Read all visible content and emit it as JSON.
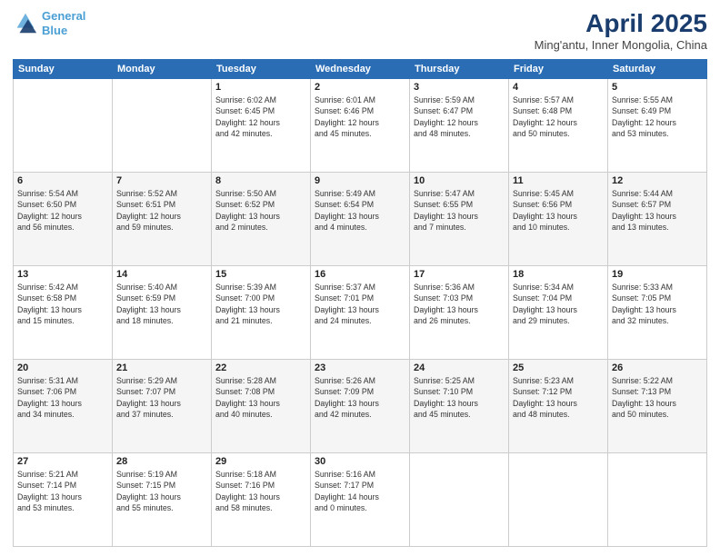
{
  "header": {
    "logo_line1": "General",
    "logo_line2": "Blue",
    "month_year": "April 2025",
    "location": "Ming'antu, Inner Mongolia, China"
  },
  "weekdays": [
    "Sunday",
    "Monday",
    "Tuesday",
    "Wednesday",
    "Thursday",
    "Friday",
    "Saturday"
  ],
  "weeks": [
    [
      {
        "day": "",
        "info": ""
      },
      {
        "day": "",
        "info": ""
      },
      {
        "day": "1",
        "info": "Sunrise: 6:02 AM\nSunset: 6:45 PM\nDaylight: 12 hours\nand 42 minutes."
      },
      {
        "day": "2",
        "info": "Sunrise: 6:01 AM\nSunset: 6:46 PM\nDaylight: 12 hours\nand 45 minutes."
      },
      {
        "day": "3",
        "info": "Sunrise: 5:59 AM\nSunset: 6:47 PM\nDaylight: 12 hours\nand 48 minutes."
      },
      {
        "day": "4",
        "info": "Sunrise: 5:57 AM\nSunset: 6:48 PM\nDaylight: 12 hours\nand 50 minutes."
      },
      {
        "day": "5",
        "info": "Sunrise: 5:55 AM\nSunset: 6:49 PM\nDaylight: 12 hours\nand 53 minutes."
      }
    ],
    [
      {
        "day": "6",
        "info": "Sunrise: 5:54 AM\nSunset: 6:50 PM\nDaylight: 12 hours\nand 56 minutes."
      },
      {
        "day": "7",
        "info": "Sunrise: 5:52 AM\nSunset: 6:51 PM\nDaylight: 12 hours\nand 59 minutes."
      },
      {
        "day": "8",
        "info": "Sunrise: 5:50 AM\nSunset: 6:52 PM\nDaylight: 13 hours\nand 2 minutes."
      },
      {
        "day": "9",
        "info": "Sunrise: 5:49 AM\nSunset: 6:54 PM\nDaylight: 13 hours\nand 4 minutes."
      },
      {
        "day": "10",
        "info": "Sunrise: 5:47 AM\nSunset: 6:55 PM\nDaylight: 13 hours\nand 7 minutes."
      },
      {
        "day": "11",
        "info": "Sunrise: 5:45 AM\nSunset: 6:56 PM\nDaylight: 13 hours\nand 10 minutes."
      },
      {
        "day": "12",
        "info": "Sunrise: 5:44 AM\nSunset: 6:57 PM\nDaylight: 13 hours\nand 13 minutes."
      }
    ],
    [
      {
        "day": "13",
        "info": "Sunrise: 5:42 AM\nSunset: 6:58 PM\nDaylight: 13 hours\nand 15 minutes."
      },
      {
        "day": "14",
        "info": "Sunrise: 5:40 AM\nSunset: 6:59 PM\nDaylight: 13 hours\nand 18 minutes."
      },
      {
        "day": "15",
        "info": "Sunrise: 5:39 AM\nSunset: 7:00 PM\nDaylight: 13 hours\nand 21 minutes."
      },
      {
        "day": "16",
        "info": "Sunrise: 5:37 AM\nSunset: 7:01 PM\nDaylight: 13 hours\nand 24 minutes."
      },
      {
        "day": "17",
        "info": "Sunrise: 5:36 AM\nSunset: 7:03 PM\nDaylight: 13 hours\nand 26 minutes."
      },
      {
        "day": "18",
        "info": "Sunrise: 5:34 AM\nSunset: 7:04 PM\nDaylight: 13 hours\nand 29 minutes."
      },
      {
        "day": "19",
        "info": "Sunrise: 5:33 AM\nSunset: 7:05 PM\nDaylight: 13 hours\nand 32 minutes."
      }
    ],
    [
      {
        "day": "20",
        "info": "Sunrise: 5:31 AM\nSunset: 7:06 PM\nDaylight: 13 hours\nand 34 minutes."
      },
      {
        "day": "21",
        "info": "Sunrise: 5:29 AM\nSunset: 7:07 PM\nDaylight: 13 hours\nand 37 minutes."
      },
      {
        "day": "22",
        "info": "Sunrise: 5:28 AM\nSunset: 7:08 PM\nDaylight: 13 hours\nand 40 minutes."
      },
      {
        "day": "23",
        "info": "Sunrise: 5:26 AM\nSunset: 7:09 PM\nDaylight: 13 hours\nand 42 minutes."
      },
      {
        "day": "24",
        "info": "Sunrise: 5:25 AM\nSunset: 7:10 PM\nDaylight: 13 hours\nand 45 minutes."
      },
      {
        "day": "25",
        "info": "Sunrise: 5:23 AM\nSunset: 7:12 PM\nDaylight: 13 hours\nand 48 minutes."
      },
      {
        "day": "26",
        "info": "Sunrise: 5:22 AM\nSunset: 7:13 PM\nDaylight: 13 hours\nand 50 minutes."
      }
    ],
    [
      {
        "day": "27",
        "info": "Sunrise: 5:21 AM\nSunset: 7:14 PM\nDaylight: 13 hours\nand 53 minutes."
      },
      {
        "day": "28",
        "info": "Sunrise: 5:19 AM\nSunset: 7:15 PM\nDaylight: 13 hours\nand 55 minutes."
      },
      {
        "day": "29",
        "info": "Sunrise: 5:18 AM\nSunset: 7:16 PM\nDaylight: 13 hours\nand 58 minutes."
      },
      {
        "day": "30",
        "info": "Sunrise: 5:16 AM\nSunset: 7:17 PM\nDaylight: 14 hours\nand 0 minutes."
      },
      {
        "day": "",
        "info": ""
      },
      {
        "day": "",
        "info": ""
      },
      {
        "day": "",
        "info": ""
      }
    ]
  ]
}
